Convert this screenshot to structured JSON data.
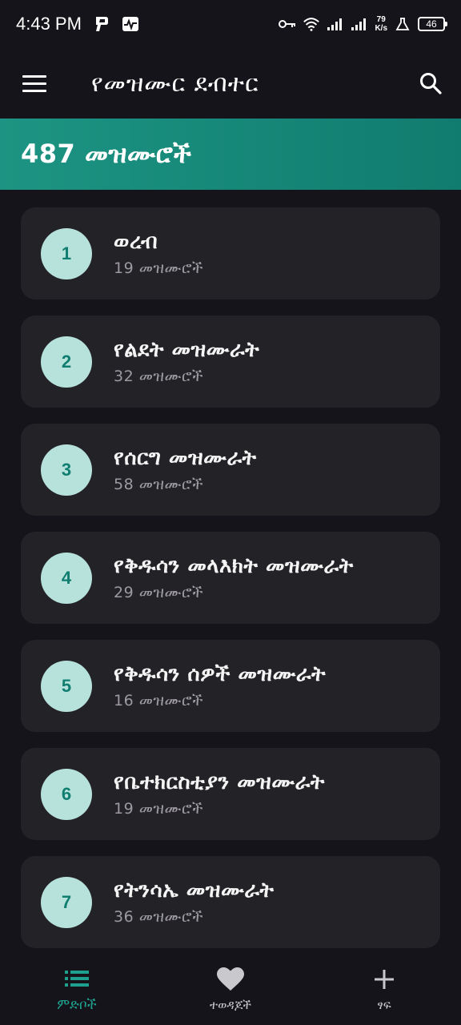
{
  "status_bar": {
    "time": "4:43 PM",
    "net_speed_value": "79",
    "net_speed_unit": "K/s",
    "battery": "46"
  },
  "app_bar": {
    "title": "የመዝሙር ደብተር"
  },
  "banner": {
    "count_text": "487 መዝሙሮች"
  },
  "categories": [
    {
      "number": "1",
      "title": "ወረብ",
      "subtitle": "19 መዝሙሮች"
    },
    {
      "number": "2",
      "title": "የልደት መዝሙራት",
      "subtitle": "32 መዝሙሮች"
    },
    {
      "number": "3",
      "title": "የሰርግ መዝሙራት",
      "subtitle": "58 መዝሙሮች"
    },
    {
      "number": "4",
      "title": "የቅዱሳን መላእክት መዝሙራት",
      "subtitle": "29 መዝሙሮች"
    },
    {
      "number": "5",
      "title": "የቅዱሳን ሰዎች መዝሙራት",
      "subtitle": "16 መዝሙሮች"
    },
    {
      "number": "6",
      "title": "የቤተክርስቲያን መዝሙራት",
      "subtitle": "19 መዝሙሮች"
    },
    {
      "number": "7",
      "title": "የትንሳኤ መዝሙራት",
      "subtitle": "36 መዝሙሮች"
    }
  ],
  "bottom_nav": [
    {
      "label": "ምድቦች",
      "icon": "list-icon",
      "active": true
    },
    {
      "label": "ተወዳጆች",
      "icon": "heart-icon",
      "active": false
    },
    {
      "label": "ፃፍ",
      "icon": "plus-icon",
      "active": false
    }
  ],
  "colors": {
    "background": "#15141a",
    "card": "#232227",
    "accent": "#1d9483",
    "circle": "#b7e2dc"
  }
}
